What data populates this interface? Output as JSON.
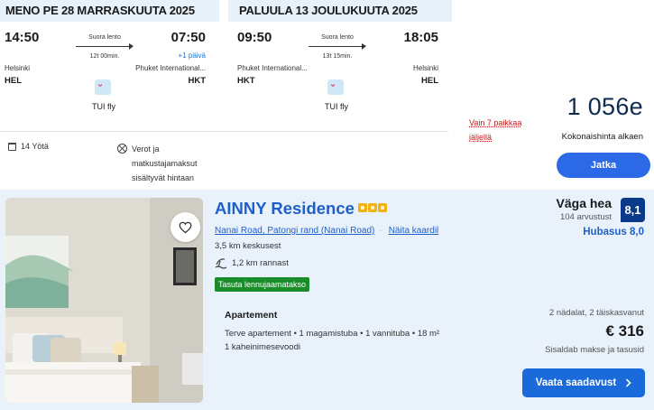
{
  "flights": {
    "outbound": {
      "header": "MENO PE 28 MARRASKUUTA 2025",
      "dep_time": "14:50",
      "arr_time": "07:50",
      "direct_label": "Suora lento",
      "duration": "12t 00min.",
      "plus_day": "+1 päivä",
      "dep_city": "Helsinki",
      "arr_city": "Phuket International...",
      "dep_code": "HEL",
      "arr_code": "HKT",
      "airline": "TUI fly"
    },
    "return": {
      "header": "PALUULA 13 JOULUKUUTA 2025",
      "dep_time": "09:50",
      "arr_time": "18:05",
      "direct_label": "Suora lento",
      "duration": "13t 15min.",
      "dep_city": "Phuket International...",
      "arr_city": "Helsinki",
      "dep_code": "HKT",
      "arr_code": "HEL",
      "airline": "TUI fly"
    }
  },
  "summary": {
    "nights": "14 Yötä",
    "taxes": "Verot ja matkustajamaksut sisältyvät hintaan",
    "seats_left": "Vain 7 paikkaa jäljellä",
    "total_price": "1 056e",
    "price_label": "Kokonaishinta alkaen",
    "continue_label": "Jatka"
  },
  "hotel": {
    "name": "AINNY Residence",
    "star_count": 3,
    "address": "Nanai Road, Patongi rand (Nanai Road)",
    "map_link": "Näita kaardil",
    "distance_center": "3,5 km keskusest",
    "distance_beach": "1,2 km rannast",
    "transfer_badge": "Tasuta lennujaamatakso",
    "room_type": "Apartement",
    "room_details_line1": "Terve apartement • 1 magamistuba • 1 vannituba • 18 m²",
    "room_details_line2": "1 kaheinimesevoodi",
    "rating_label": "Väga hea",
    "review_count": "104 arvustust",
    "score": "8,1",
    "cleanliness": "Hubasus 8,0",
    "stay_info": "2 nädalat, 2 täiskasvanut",
    "price": "€ 316",
    "price_includes": "Sisaldab makse ja tasusid",
    "availability_label": "Vaata saadavust"
  },
  "colors": {
    "header_bg": "#e6f1f9",
    "brand_blue": "#1e60c8",
    "button_blue": "#2c69e6",
    "score_navy": "#0b3a8a",
    "badge_green": "#1a8d2b",
    "alert_red": "#c4161c"
  },
  "icons": [
    "calendar-icon",
    "no-fees-icon",
    "heart-icon",
    "beach-icon",
    "chevron-right-icon",
    "tui-logo-icon",
    "star-icon"
  ]
}
